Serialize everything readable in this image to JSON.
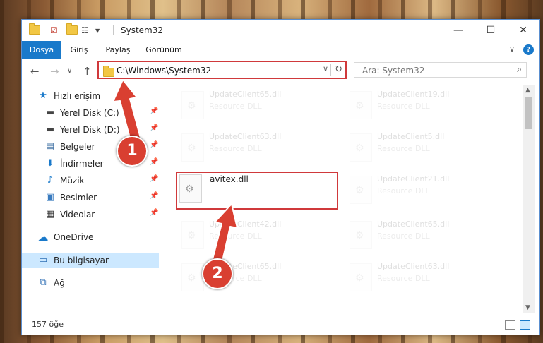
{
  "window": {
    "title": "System32",
    "controls": {
      "minimize": "—",
      "maximize": "☐",
      "close": "✕"
    }
  },
  "ribbon": {
    "tabs": [
      "Dosya",
      "Giriş",
      "Paylaş",
      "Görünüm"
    ],
    "expand": "∨",
    "help": "?"
  },
  "address": {
    "back": "←",
    "forward": "→",
    "recent": "∨",
    "up": "↑",
    "path": "C:\\Windows\\System32",
    "dropdown": "∨",
    "refresh": "↻"
  },
  "search": {
    "placeholder": "Ara: System32",
    "icon": "search-icon"
  },
  "sidebar": {
    "items": [
      {
        "label": "Hızlı erişim",
        "icon": "star-icon",
        "glyph": "★"
      },
      {
        "label": "Yerel Disk (C:)",
        "icon": "drive-icon",
        "glyph": "▬",
        "pin": "📌"
      },
      {
        "label": "Yerel Disk (D:)",
        "icon": "drive-icon",
        "glyph": "▬",
        "pin": "📌"
      },
      {
        "label": "Belgeler",
        "icon": "document-icon",
        "glyph": "▤",
        "pin": "📌"
      },
      {
        "label": "İndirmeler",
        "icon": "download-icon",
        "glyph": "⬇",
        "pin": "📌"
      },
      {
        "label": "Müzik",
        "icon": "music-icon",
        "glyph": "♪",
        "pin": "📌"
      },
      {
        "label": "Resimler",
        "icon": "pictures-icon",
        "glyph": "▣",
        "pin": "📌"
      },
      {
        "label": "Videolar",
        "icon": "video-icon",
        "glyph": "▦",
        "pin": "📌"
      },
      {
        "label": "OneDrive",
        "icon": "cloud-icon",
        "glyph": "☁"
      },
      {
        "label": "Bu bilgisayar",
        "icon": "computer-icon",
        "glyph": "▭"
      },
      {
        "label": "Ağ",
        "icon": "network-icon",
        "glyph": "⧉"
      }
    ]
  },
  "files": [
    {
      "name": "UpdateClient65.dll",
      "type": "Resource DLL"
    },
    {
      "name": "UpdateClient19.dll",
      "type": "Resource DLL"
    },
    {
      "name": "UpdateClient63.dll",
      "type": "Resource DLL"
    },
    {
      "name": "UpdateClient5.dll",
      "type": "Resource DLL"
    },
    {
      "name": "avitex.dll",
      "type": ""
    },
    {
      "name": "UpdateClient21.dll",
      "type": "Resource DLL"
    },
    {
      "name": "UpdateClient42.dll",
      "type": "Resource DLL"
    },
    {
      "name": "UpdateClient65.dll",
      "type": "Resource DLL"
    },
    {
      "name": "UpdateClient65.dll",
      "type": "Resource DLL"
    },
    {
      "name": "UpdateClient63.dll",
      "type": "Resource DLL"
    }
  ],
  "status": {
    "count": "157 öğe"
  },
  "annotations": {
    "step1": "1",
    "step2": "2",
    "color": "#d93f31"
  }
}
